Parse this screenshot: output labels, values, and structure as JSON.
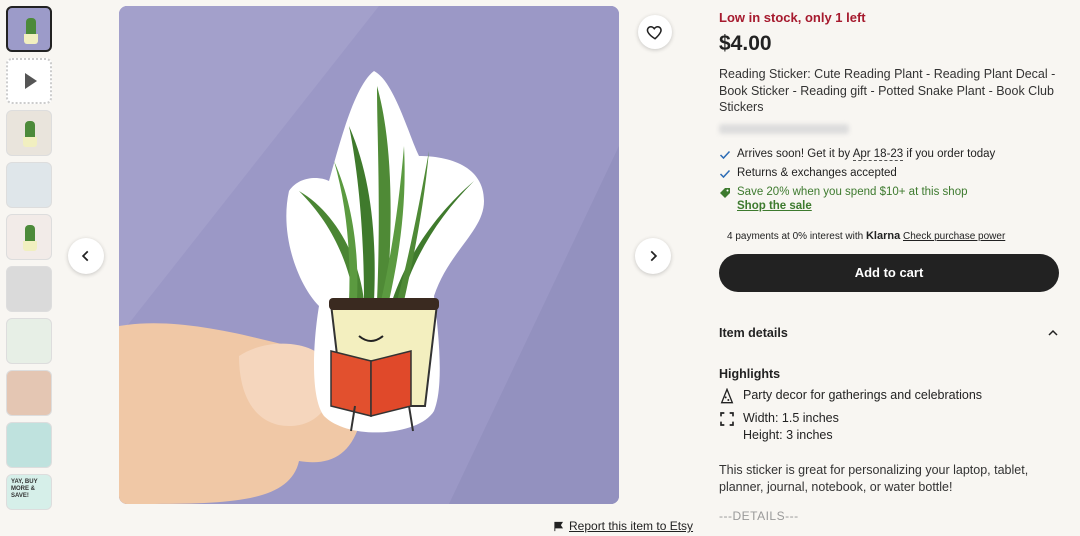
{
  "listing": {
    "stock_text": "Low in stock, only 1 left",
    "price": "$4.00",
    "title": "Reading Sticker: Cute Reading Plant - Reading Plant Decal - Book Sticker - Reading gift - Potted Snake Plant - Book Club Stickers"
  },
  "perks": {
    "arrives_prefix": "Arrives soon! Get it by ",
    "arrives_dates": "Apr 18-23",
    "arrives_suffix": " if you order today",
    "returns": "Returns & exchanges accepted",
    "promo": "Save 20% when you spend $10+ at this shop",
    "shop_sale": "Shop the sale"
  },
  "klarna": {
    "prefix": "4 payments at 0% interest with ",
    "brand": "Klarna",
    "link": "Check purchase power"
  },
  "cart": {
    "label": "Add to cart"
  },
  "item_details": {
    "heading": "Item details",
    "highlights_heading": "Highlights",
    "highlight_party": "Party decor for gatherings and celebrations",
    "width": "Width: 1.5 inches",
    "height": "Height: 3 inches",
    "description": "This sticker is great for personalizing your laptop, tablet, planner, journal, notebook, or water bottle!",
    "details_label": "---DETAILS---"
  },
  "report": {
    "label": "Report this item to Etsy"
  },
  "thumbnails": {
    "t10_text": "YAY, BUY MORE & SAVE!"
  },
  "colors": {
    "stock": "#a61a2e",
    "promo_green": "#3d7a2e",
    "cart_bg": "#222222",
    "image_bg": "#9b98c6"
  },
  "icons": {
    "favorite": "heart-icon",
    "prev": "chevron-left-icon",
    "next": "chevron-right-icon",
    "check": "check-icon",
    "tag": "tag-icon",
    "party": "party-hat-icon",
    "dimensions": "dimensions-icon",
    "collapse": "chevron-up-icon",
    "flag": "flag-icon",
    "play": "play-icon"
  }
}
